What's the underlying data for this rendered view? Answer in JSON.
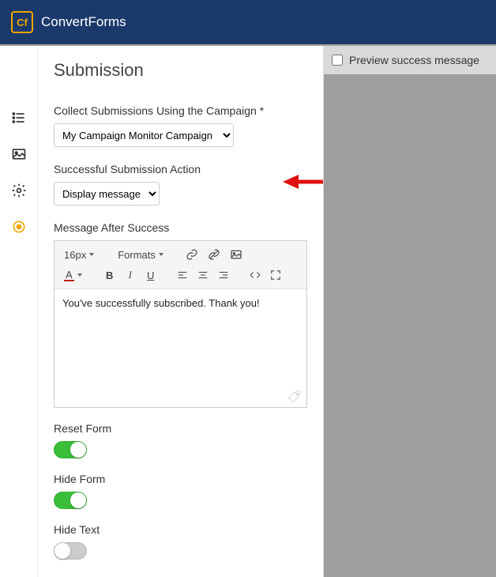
{
  "brand": {
    "logo_text": "Cf",
    "name": "ConvertForms"
  },
  "sidebar": {
    "icons": [
      "list-icon",
      "image-icon",
      "gear-icon",
      "target-icon"
    ],
    "active_index": 3
  },
  "panel": {
    "title": "Submission",
    "campaign_label": "Collect Submissions Using the Campaign *",
    "campaign_value": "My Campaign Monitor Campaign",
    "action_label": "Successful Submission Action",
    "action_value": "Display message",
    "message_label": "Message After Success",
    "editor": {
      "font_size": "16px",
      "formats_label": "Formats",
      "content": "You've successfully subscribed. Thank you!"
    },
    "reset_form_label": "Reset Form",
    "reset_form_on": true,
    "hide_form_label": "Hide Form",
    "hide_form_on": true,
    "hide_text_label": "Hide Text",
    "hide_text_on": false
  },
  "preview": {
    "checkbox_label": "Preview success message",
    "checked": false
  }
}
